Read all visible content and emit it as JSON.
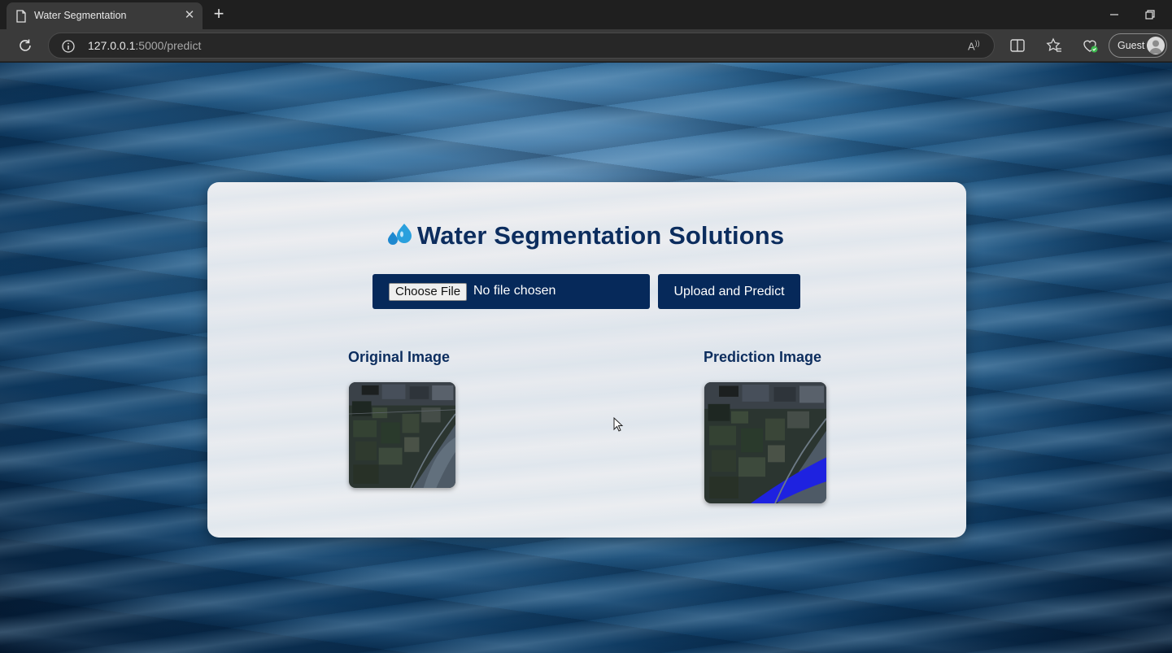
{
  "browser": {
    "tab": {
      "title": "Water Segmentation",
      "icon": "page-icon",
      "close_icon": "close-icon"
    },
    "new_tab_icon": "plus-icon",
    "window_controls": [
      "minimize-icon",
      "restore-icon"
    ],
    "address": {
      "host": "127.0.0.1",
      "path": ":5000/predict",
      "info_icon": "info-icon"
    },
    "profile_label": "Guest",
    "toolbar_icons": [
      "read-aloud-icon",
      "split-screen-icon",
      "favorites-icon",
      "browser-essentials-icon"
    ]
  },
  "page": {
    "title": "Water Segmentation Solutions",
    "title_icon": "water-drops-icon",
    "file_input": {
      "button_label": "Choose File",
      "status": "No file chosen"
    },
    "upload_button": "Upload and Predict",
    "original_title": "Original Image",
    "prediction_title": "Prediction Image"
  },
  "colors": {
    "brand_navy": "#06295a",
    "title_text": "#0c2d5e",
    "water_mask": "#1e22e0"
  }
}
